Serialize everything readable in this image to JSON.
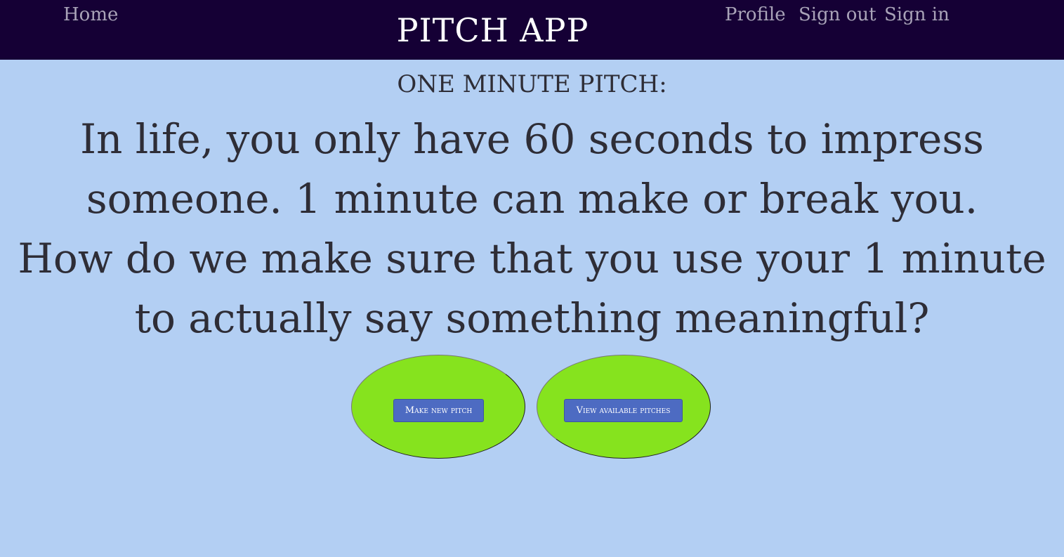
{
  "navbar": {
    "home_label": "Home",
    "brand": "PITCH APP",
    "profile_label": "Profile",
    "signout_label": "Sign out",
    "signin_label": "Sign in",
    "background_color": "#150035"
  },
  "main": {
    "subtitle": "ONE MINUTE PITCH:",
    "line1": "In life, you only have 60 seconds to impress someone. 1 minute can make or break you.",
    "line2": "How do we make sure that you use your 1 minute to actually say something meaningful?",
    "background_color": "#b3cff3"
  },
  "actions": {
    "make_pitch_label": "Make new pitch",
    "view_pitches_label": "View available pitches",
    "blob_color": "#86e31e",
    "button_color": "#4d6bc2"
  }
}
